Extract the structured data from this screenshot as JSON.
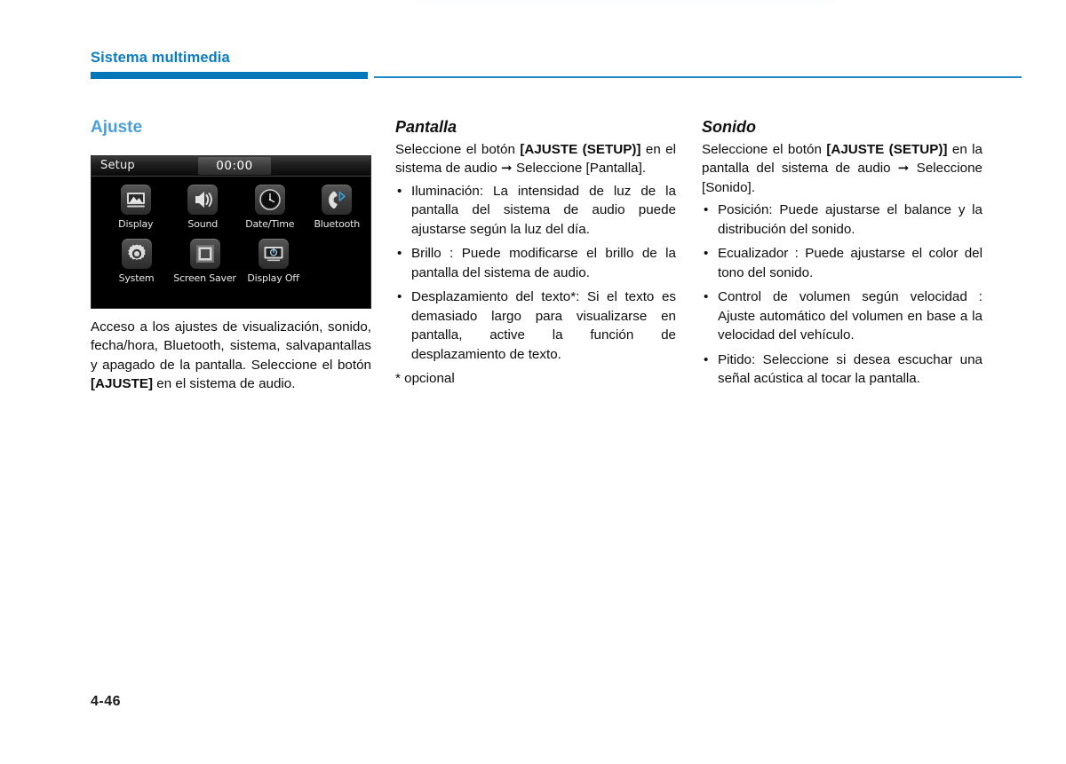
{
  "page": {
    "running_header": "Sistema multimedia",
    "page_number": "4-46",
    "accent_color": "#0077b8",
    "heading_color": "#4a9fd8"
  },
  "left_column": {
    "heading": "Ajuste",
    "device": {
      "title": "Setup",
      "clock": "00:00",
      "icons": [
        {
          "label": "Display",
          "icon": "picture-icon"
        },
        {
          "label": "Sound",
          "icon": "speaker-icon"
        },
        {
          "label": "Date/Time",
          "icon": "clock-icon"
        },
        {
          "label": "Bluetooth",
          "icon": "bluetooth-phone-icon"
        },
        {
          "label": "System",
          "icon": "gear-icon"
        },
        {
          "label": "Screen Saver",
          "icon": "screensaver-icon"
        },
        {
          "label": "Display Off",
          "icon": "display-off-icon"
        }
      ]
    },
    "body_1": "Acceso a los ajustes de visualización, sonido, fecha/hora, Bluetooth, sistema, salvapantallas y apagado de la pantalla. Seleccione el botón ",
    "body_1_bold": "[AJUSTE]",
    "body_1_tail": " en el sistema de audio."
  },
  "middle_column": {
    "heading": "Pantalla",
    "intro_pre": "Seleccione el botón ",
    "intro_bold": "[AJUSTE (SETUP)]",
    "intro_post": " en el sistema de audio ➞ Seleccione [Pantalla].",
    "bullets": [
      "Iluminación: La intensidad de luz de la pantalla del sistema de audio puede ajustarse según la luz del día.",
      "Brillo : Puede modificarse el brillo de la pantalla del sistema de audio.",
      "Desplazamiento del texto*: Si el texto es demasiado largo para visualizarse en pantalla, active la función de desplazamiento de texto."
    ],
    "footnote": "* opcional"
  },
  "right_column": {
    "heading": "Sonido",
    "intro_pre": "Seleccione el botón ",
    "intro_bold": "[AJUSTE (SETUP)]",
    "intro_post": " en la pantalla del sistema de audio ➞ Seleccione [Sonido].",
    "bullets": [
      "Posición: Puede ajustarse el balance y la distribución del sonido.",
      "Ecualizador : Puede ajustarse el color del tono del sonido.",
      "Control de volumen según velocidad : Ajuste automático del volumen en base a la velocidad del vehículo.",
      "Pitido: Seleccione si desea escuchar una señal acústica al tocar la pantalla."
    ]
  }
}
